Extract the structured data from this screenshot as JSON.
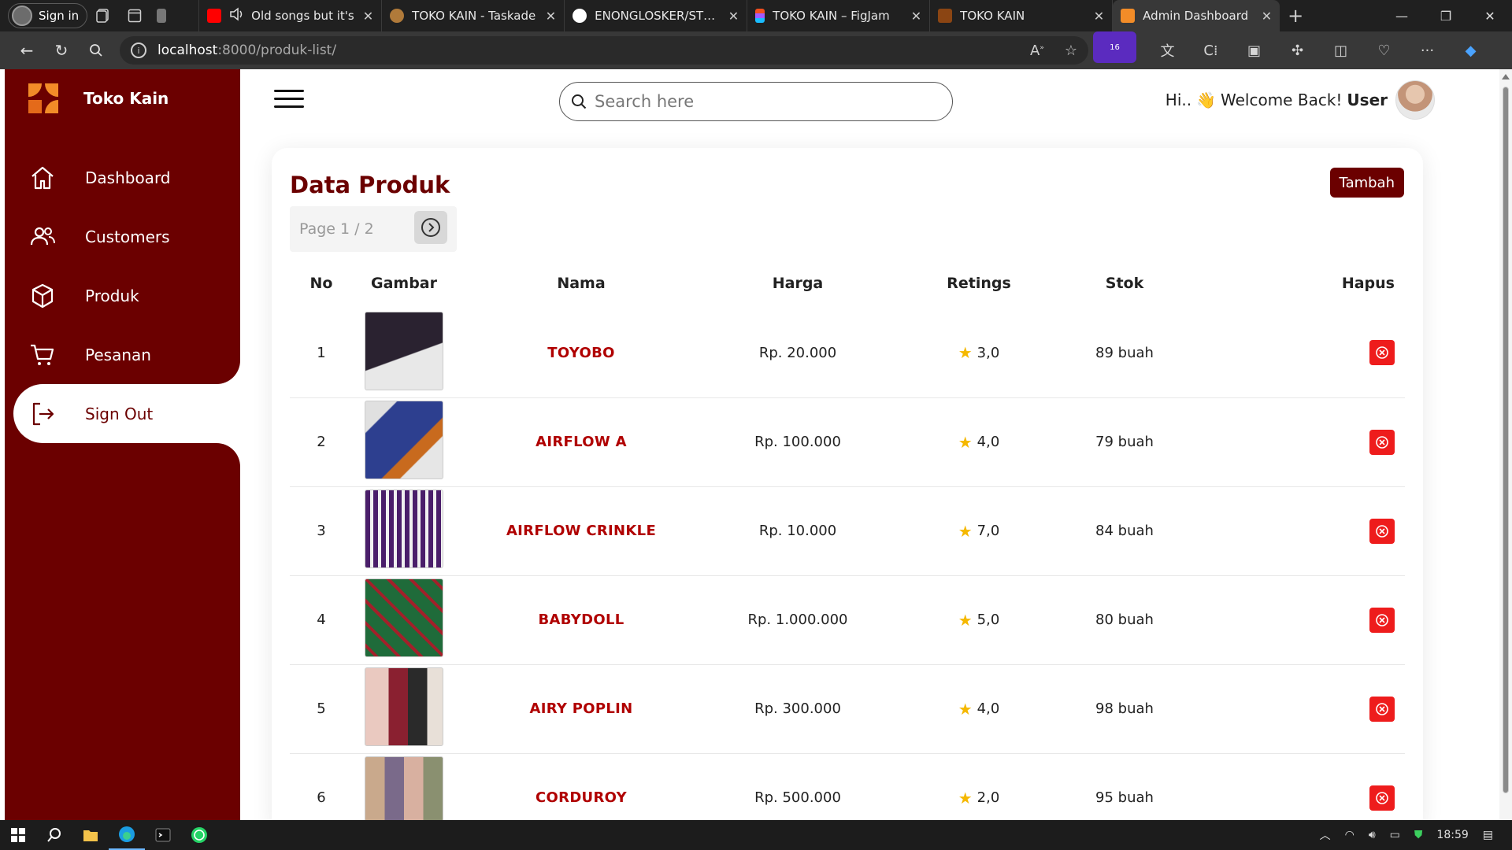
{
  "browser": {
    "profile_label": "Sign in",
    "tabs": [
      {
        "title": "Old songs but it's",
        "color": "#ff0000"
      },
      {
        "title": "TOKO KAIN - Taskade",
        "color": "#b07a3a"
      },
      {
        "title": "ENONGLOSKER/STORE",
        "color": "#ffffff"
      },
      {
        "title": "TOKO KAIN – FigJam",
        "color": "#a259ff"
      },
      {
        "title": "TOKO KAIN",
        "color": "#8b4513"
      },
      {
        "title": "Admin Dashboard",
        "color": "#f28c28"
      }
    ],
    "url_host": "localhost",
    "url_path": ":8000/produk-list/",
    "ext_badge": "16"
  },
  "brand": {
    "name": "Toko Kain"
  },
  "sidebar": {
    "items": [
      {
        "label": "Dashboard",
        "icon": "home-icon"
      },
      {
        "label": "Customers",
        "icon": "users-icon"
      },
      {
        "label": "Produk",
        "icon": "box-icon"
      },
      {
        "label": "Pesanan",
        "icon": "cart-icon"
      },
      {
        "label": "Sign Out",
        "icon": "signout-icon"
      }
    ]
  },
  "topbar": {
    "search_placeholder": "Search here",
    "greeting": "Hi..",
    "welcome": "Welcome Back!",
    "user": "User"
  },
  "main": {
    "title": "Data Produk",
    "add_label": "Tambah",
    "pager": "Page 1 / 2",
    "columns": [
      "No",
      "Gambar",
      "Nama",
      "Harga",
      "Retings",
      "Stok",
      "Hapus"
    ],
    "rows": [
      {
        "no": "1",
        "nama": "TOYOBO",
        "harga": "Rp. 20.000",
        "rating": "3,0",
        "stok": "89 buah"
      },
      {
        "no": "2",
        "nama": "AIRFLOW A",
        "harga": "Rp. 100.000",
        "rating": "4,0",
        "stok": "79 buah"
      },
      {
        "no": "3",
        "nama": "AIRFLOW CRINKLE",
        "harga": "Rp. 10.000",
        "rating": "7,0",
        "stok": "84 buah"
      },
      {
        "no": "4",
        "nama": "BABYDOLL",
        "harga": "Rp. 1.000.000",
        "rating": "5,0",
        "stok": "80 buah"
      },
      {
        "no": "5",
        "nama": "AIRY POPLIN",
        "harga": "Rp. 300.000",
        "rating": "4,0",
        "stok": "98 buah"
      },
      {
        "no": "6",
        "nama": "CORDUROY",
        "harga": "Rp. 500.000",
        "rating": "2,0",
        "stok": "95 buah"
      }
    ]
  },
  "taskbar": {
    "time": "18:59"
  },
  "colors": {
    "primary": "#6b0000",
    "product_name": "#b00000",
    "delete": "#ee1c1c",
    "star": "#f5b800"
  }
}
